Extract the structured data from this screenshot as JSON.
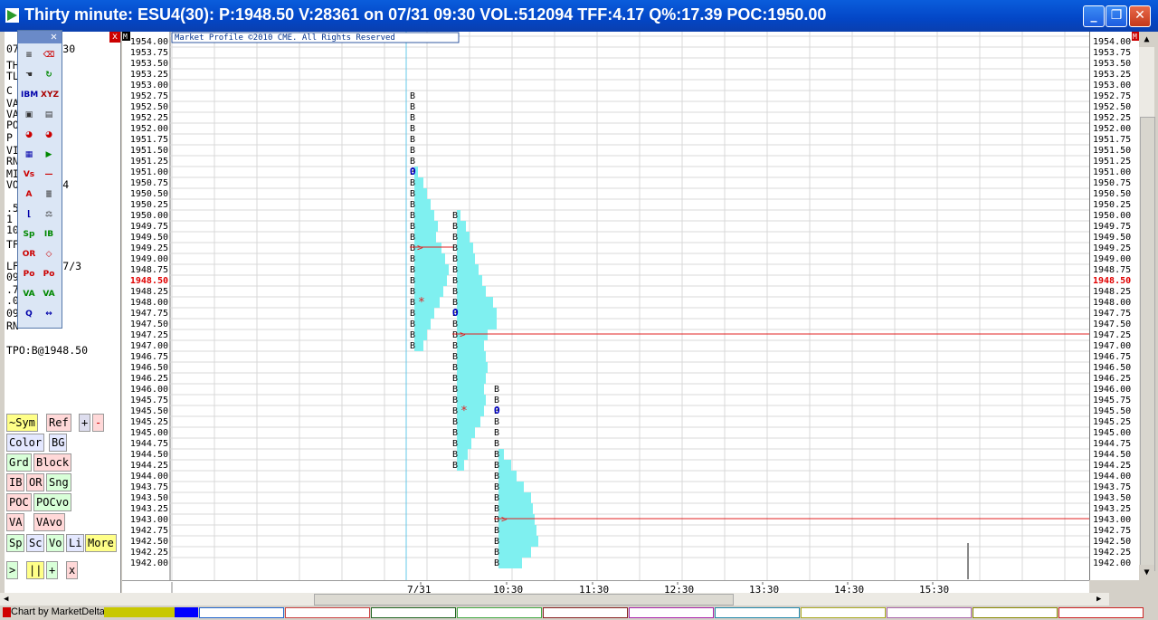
{
  "window": {
    "title": "Thirty minute: ESU4(30): P:1948.50 V:28361 on 07/31 09:30 VOL:512094 TFF:4.17 Q%:17.39 POC:1950.00",
    "minimize_glyph": "_",
    "maximize_glyph": "❐",
    "close_glyph": "✕"
  },
  "chart": {
    "copyright": "Market Profile ©2010 CME. All Rights Reserved",
    "current_price": "1948.50",
    "price_labels": [
      "1954.00",
      "1953.75",
      "1953.50",
      "1953.25",
      "1953.00",
      "1952.75",
      "1952.50",
      "1952.25",
      "1952.00",
      "1951.75",
      "1951.50",
      "1951.25",
      "1951.00",
      "1950.75",
      "1950.50",
      "1950.25",
      "1950.00",
      "1949.75",
      "1949.50",
      "1949.25",
      "1949.00",
      "1948.75",
      "1948.50",
      "1948.25",
      "1948.00",
      "1947.75",
      "1947.50",
      "1947.25",
      "1947.00",
      "1946.75",
      "1946.50",
      "1946.25",
      "1946.00",
      "1945.75",
      "1945.50",
      "1945.25",
      "1945.00",
      "1944.75",
      "1944.50",
      "1944.25",
      "1944.00",
      "1943.75",
      "1943.50",
      "1943.25",
      "1943.00",
      "1942.75",
      "1942.50",
      "1942.25",
      "1942.00"
    ],
    "time_labels": [
      "7/31",
      "10:30",
      "11:30",
      "12:30",
      "13:30",
      "14:30",
      "15:30"
    ],
    "tpo_letter": "B",
    "open_marker": "O",
    "poc_marker": ">",
    "mid_marker": "*",
    "pane_tag_left": "M",
    "pane_tag_right": "M",
    "colors": {
      "histogram": "#7ff0f0",
      "poc_line": "#e02020",
      "grid": "#d8d8d8",
      "current_price": "#e00000",
      "open": "#0000cc"
    }
  },
  "left_panel": {
    "close_glyph": "x",
    "lines": [
      "07/31 09:30",
      "TH",
      "TL",
      "C        , 17.4",
      "VA     .50",
      "VA     .50",
      "PO     .00",
      "P",
      "VI",
      "RN     (23x1)",
      "MI     .75",
      "VO     (512094",
      "",
      "        .50",
      "        1 (28361",
      "        105/9262",
      "TF      7/6)",
      "",
      "LF      9:30 07/3",
      "         094",
      "          .75",
      "          .00",
      "          094",
      "RN",
      "",
      "TPO:B@1948.50"
    ],
    "buttons_row1": [
      "~Sym",
      "Ref",
      "+",
      "-"
    ],
    "buttons_row2": [
      "Color",
      "BG"
    ],
    "buttons_row3": [
      "Grd",
      "Block"
    ],
    "buttons_row4": [
      "IB",
      "OR",
      "Sng"
    ],
    "buttons_row5": [
      "POC",
      "POCvo"
    ],
    "buttons_row6": [
      "VA",
      "VAvo"
    ],
    "buttons_row7": [
      "Sp",
      "Sc",
      "Vo",
      "Li",
      "More"
    ],
    "buttons_row8": [
      ">",
      "||",
      "+",
      "x"
    ]
  },
  "toolbar": {
    "icons": [
      "list-icon",
      "edit-icon",
      "hand-icon",
      "refresh-icon",
      "ibm-icon",
      "xyz-icon",
      "camera-icon",
      "page-icon",
      "pie-icon",
      "pie2-icon",
      "grid-icon",
      "play-icon",
      "vs-icon",
      "line-icon",
      "text-icon",
      "align-icon",
      "bracket-icon",
      "scale-icon",
      "sp-icon",
      "ib-icon",
      "or-icon",
      "diamond-icon",
      "poc-icon",
      "pocvo-icon",
      "va-icon",
      "vavo-icon",
      "q-icon",
      "arrows-icon"
    ],
    "labels": {
      "ibm": "IBM",
      "sp": "Sp",
      "ib": "IB",
      "or": "OR",
      "va": "VA",
      "poc": "Po c",
      "pocvo": "Po cv",
      "q": "Q",
      "vavo": "VA vo",
      "xyz": "XYZ",
      "vs": "V S"
    }
  },
  "footer": {
    "credit": "Chart by MarketDelta"
  }
}
